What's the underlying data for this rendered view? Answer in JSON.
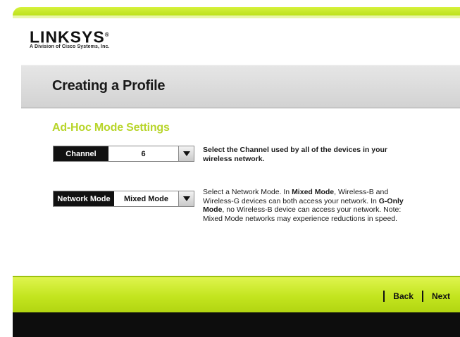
{
  "brand": {
    "logo_text": "LINKSYS",
    "logo_mark": "®",
    "tagline": "A Division of Cisco Systems, Inc."
  },
  "page": {
    "title": "Creating a Profile",
    "section_heading": "Ad-Hoc Mode Settings"
  },
  "fields": {
    "channel": {
      "label": "Channel",
      "value": "6",
      "help": "Select the Channel used by all of the devices in your wireless network."
    },
    "network_mode": {
      "label": "Network Mode",
      "value": "Mixed Mode",
      "help_1": "Select a Network Mode. In ",
      "help_2": "Mixed Mode",
      "help_3": ", Wireless-B and Wireless-G devices can both access your network. In ",
      "help_4": "G-Only Mode",
      "help_5": ", no Wireless-B device can access your network. Note: Mixed Mode networks may experience reductions in speed."
    }
  },
  "footer": {
    "back_label": "Back",
    "next_label": "Next"
  },
  "icons": {
    "dropdown": "chevron-down-icon"
  },
  "colors": {
    "accent_green": "#c3e51f",
    "heading_green": "#b8d52b"
  }
}
